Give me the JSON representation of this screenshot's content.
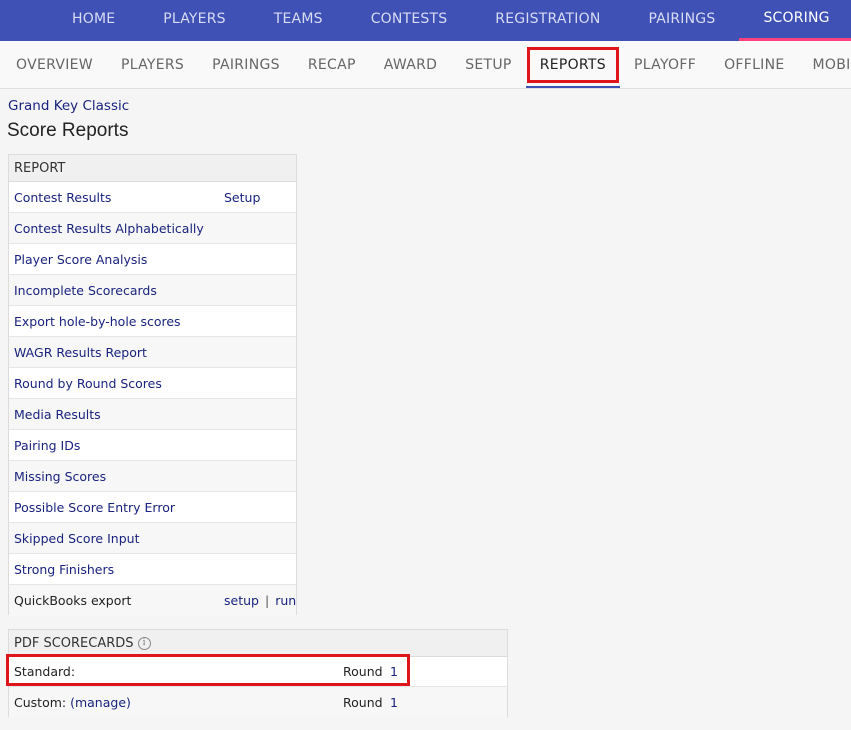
{
  "topnav": {
    "items": [
      "HOME",
      "PLAYERS",
      "TEAMS",
      "CONTESTS",
      "REGISTRATION",
      "PAIRINGS",
      "SCORING"
    ],
    "active": "SCORING"
  },
  "subnav": {
    "items": [
      "OVERVIEW",
      "PLAYERS",
      "PAIRINGS",
      "RECAP",
      "AWARD",
      "SETUP",
      "REPORTS",
      "PLAYOFF",
      "OFFLINE",
      "MOBILE"
    ],
    "active": "REPORTS"
  },
  "breadcrumb": "Grand Key Classic",
  "page_title": "Score Reports",
  "report_table": {
    "header": "REPORT",
    "rows": [
      {
        "label": "Contest Results",
        "right": "Setup"
      },
      {
        "label": "Contest Results Alphabetically"
      },
      {
        "label": "Player Score Analysis"
      },
      {
        "label": "Incomplete Scorecards"
      },
      {
        "label": "Export hole-by-hole scores"
      },
      {
        "label": "WAGR Results Report"
      },
      {
        "label": "Round by Round Scores"
      },
      {
        "label": "Media Results"
      },
      {
        "label": "Pairing IDs"
      },
      {
        "label": "Missing Scores"
      },
      {
        "label": "Possible Score Entry Error"
      },
      {
        "label": "Skipped Score Input"
      },
      {
        "label": "Strong Finishers"
      }
    ],
    "quickbooks": {
      "label": "QuickBooks export",
      "setup": "setup",
      "separator": "|",
      "run": "run"
    }
  },
  "pdf_scorecards": {
    "header": "PDF SCORECARDS",
    "info_icon": "info-circle-icon",
    "standard": {
      "label": "Standard:",
      "round_label": "Round",
      "round_value": "1"
    },
    "custom": {
      "label": "Custom:",
      "manage": "(manage)",
      "round_label": "Round",
      "round_value": "1"
    }
  },
  "colors": {
    "topnav_bg": "#3f51b5",
    "active_underline": "#ff4081",
    "link": "#1a237e",
    "highlight_box": "#e0151b"
  }
}
